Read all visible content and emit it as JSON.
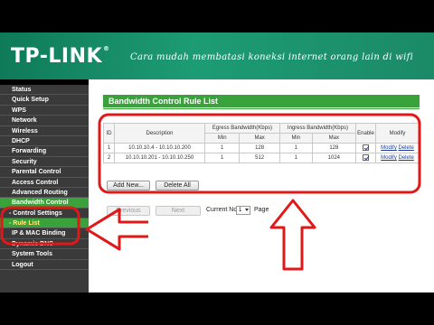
{
  "header": {
    "logo": "TP-LINK",
    "logo_reg": "®",
    "tagline": "Cara mudah membatasi koneksi internet orang lain di wifi"
  },
  "sidebar": {
    "items": [
      {
        "label": "Status"
      },
      {
        "label": "Quick Setup"
      },
      {
        "label": "WPS"
      },
      {
        "label": "Network"
      },
      {
        "label": "Wireless"
      },
      {
        "label": "DHCP"
      },
      {
        "label": "Forwarding"
      },
      {
        "label": "Security"
      },
      {
        "label": "Parental Control"
      },
      {
        "label": "Access Control"
      },
      {
        "label": "Advanced Routing"
      },
      {
        "label": "Bandwidth Control"
      },
      {
        "label": "- Control Settings"
      },
      {
        "label": "- Rule List"
      },
      {
        "label": "IP & MAC Binding"
      },
      {
        "label": "Dynamic DNS"
      },
      {
        "label": "System Tools"
      },
      {
        "label": "Logout"
      }
    ]
  },
  "panel": {
    "title": "Bandwidth Control Rule List"
  },
  "table": {
    "headers": {
      "id": "ID",
      "description": "Description",
      "egress": "Egress Bandwidth(Kbps)",
      "ingress": "Ingress Bandwidth(Kbps)",
      "enable": "Enable",
      "modify": "Modify",
      "min": "Min",
      "max": "Max"
    },
    "rows": [
      {
        "id": "1",
        "description": "10.10.10.4 - 10.10.10.200",
        "egress_min": "1",
        "egress_max": "128",
        "ingress_min": "1",
        "ingress_max": "128",
        "modify": "Modify",
        "delete": "Delete"
      },
      {
        "id": "2",
        "description": "10.10.10.201 - 10.10.10.250",
        "egress_min": "1",
        "egress_max": "512",
        "ingress_min": "1",
        "ingress_max": "1024",
        "modify": "Modify",
        "delete": "Delete"
      }
    ]
  },
  "buttons": {
    "add_new": "Add New...",
    "delete_all": "Delete All",
    "previous": "Previous",
    "next": "Next"
  },
  "pager": {
    "current_label": "Current No.",
    "current_value": "1",
    "page_label": "Page"
  },
  "colors": {
    "brand_green": "#3aa23a",
    "header_teal": "#1b8a66",
    "annotation_red": "#e01818",
    "link_blue": "#1c3d9e"
  }
}
